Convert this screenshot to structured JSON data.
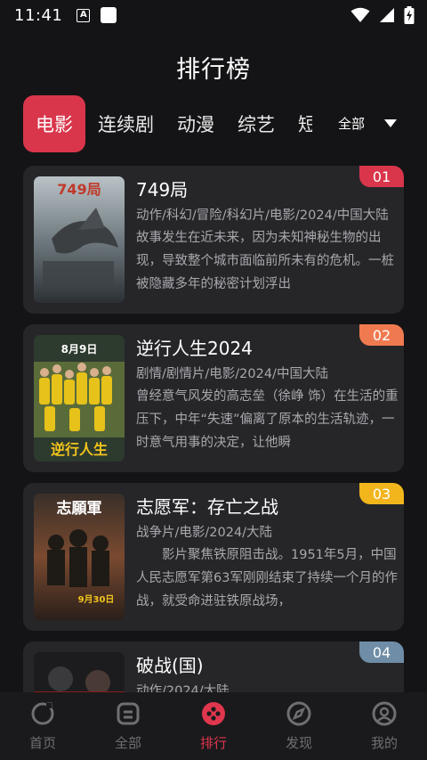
{
  "status": {
    "time": "11:41",
    "a_badge": "A"
  },
  "header": {
    "title": "排行榜"
  },
  "tabs": {
    "items": [
      {
        "label": "电影",
        "active": true
      },
      {
        "label": "连续剧"
      },
      {
        "label": "动漫"
      },
      {
        "label": "综艺"
      },
      {
        "label": "短"
      }
    ],
    "all_label": "全部"
  },
  "colors": {
    "accent": "#d9364b",
    "rank1": "#d9364b",
    "rank2": "#f07a50",
    "rank3": "#f2b51c",
    "rank4": "#6f8da6"
  },
  "list": [
    {
      "rank": "01",
      "title": "749局",
      "tags": "动作/科幻/冒险/科幻片/电影/2024/中国大陆",
      "desc": "故事发生在近未来，因为未知神秘生物的出现，导致整个城市面临前所未有的危机。一桩被隐藏多年的秘密计划浮出"
    },
    {
      "rank": "02",
      "title": "逆行人生2024",
      "tags": "剧情/剧情片/电影/2024/中国大陆",
      "desc": "曾经意气风发的高志垒（徐峥 饰）在生活的重压下，中年“失速”偏离了原本的生活轨迹，一时意气用事的决定，让他瞬"
    },
    {
      "rank": "03",
      "title": "志愿军：存亡之战",
      "tags": "战争片/电影/2024/大陆",
      "desc": "　　影片聚焦铁原阻击战。1951年5月，中国人民志愿军第63军刚刚结束了持续一个月的作战，就受命进驻铁原战场，"
    },
    {
      "rank": "04",
      "title": "破战(国)",
      "tags": "动作/2024/大陆",
      "desc": ""
    }
  ],
  "posters": [
    {
      "text_top": "749局"
    },
    {
      "text_top": "8月9日",
      "text_bottom": "逆行人生"
    },
    {
      "text_top": "志願軍",
      "text_bottom": "9月30日"
    },
    {
      "text_top": ""
    }
  ],
  "nav": [
    {
      "label": "首页",
      "icon": "refresh-icon"
    },
    {
      "label": "全部",
      "icon": "category-icon"
    },
    {
      "label": "排行",
      "icon": "ranking-icon",
      "active": true
    },
    {
      "label": "发现",
      "icon": "compass-icon"
    },
    {
      "label": "我的",
      "icon": "profile-icon"
    }
  ]
}
